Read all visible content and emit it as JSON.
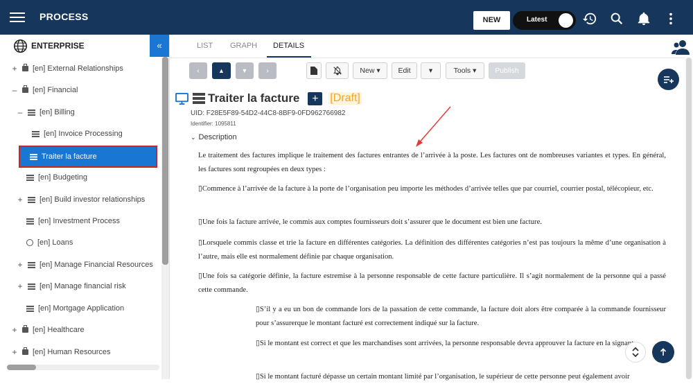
{
  "header": {
    "title": "PROCESS",
    "new_label": "NEW",
    "version_toggle": "Latest"
  },
  "sidebar": {
    "title": "ENTERPRISE",
    "collapse_glyph": "«",
    "items": [
      {
        "label": "[en] External Relationships",
        "toggle": "+",
        "icon": "bag"
      },
      {
        "label": "[en] Financial",
        "toggle": "–",
        "icon": "bag"
      },
      {
        "label": "[en] Billing",
        "toggle": "–",
        "icon": "list"
      },
      {
        "label": "[en] Invoice Processing",
        "toggle": "",
        "icon": "list"
      },
      {
        "label": "Traiter la facture",
        "toggle": "",
        "icon": "list",
        "selected": true
      },
      {
        "label": "[en] Budgeting",
        "toggle": "",
        "icon": "list"
      },
      {
        "label": "[en] Build investor relationships",
        "toggle": "+",
        "icon": "list"
      },
      {
        "label": "[en] Investment Process",
        "toggle": "",
        "icon": "list"
      },
      {
        "label": "[en] Loans",
        "toggle": "",
        "icon": "globe"
      },
      {
        "label": "[en] Manage Financial Resources",
        "toggle": "+",
        "icon": "list"
      },
      {
        "label": "[en] Manage financial risk",
        "toggle": "+",
        "icon": "list"
      },
      {
        "label": "[en] Mortgage Application",
        "toggle": "",
        "icon": "list"
      },
      {
        "label": "[en] Healthcare",
        "toggle": "+",
        "icon": "bag"
      },
      {
        "label": "[en] Human Resources",
        "toggle": "+",
        "icon": "bag"
      }
    ]
  },
  "tabs": [
    "LIST",
    "GRAPH",
    "DETAILS"
  ],
  "toolbar": {
    "new_label": "New ▾",
    "edit_label": "Edit",
    "edit_dropdown": "▾",
    "tools_label": "Tools ▾",
    "publish_label": "Publish"
  },
  "document": {
    "title": "Traiter la facture",
    "add_glyph": "+",
    "status": "[Draft]",
    "uid": "UID: F28E5F89-54D2-44C8-8BF9-0FD962766982",
    "identifier": "Identifier: 1095811",
    "description_label": "Description",
    "paragraphs": [
      "Le traitement des factures implique le traitement des factures entrantes de l’arrivée à la poste. Les factures ont de nombreuses variantes et types. En général, les factures sont regroupées en deux types :",
      "Commence à l’arrivée de la facture à la porte de l’organisation peu importe les méthodes d’arrivée telles que par courriel, courrier postal, télécopieur, etc.",
      "Une fois la facture arrivée, le commis aux comptes fournisseurs doit s’assurer que le document est bien une facture.",
      "Lorsquele commis classe et trie la facture en différentes catégories. La définition des différentes catégories n’est pas toujours la même d’une organisation à l’autre, mais elle est normalement définie par chaque organisation.",
      "Une fois sa catégorie définie, la facture estremise à la personne responsable de cette facture particulière. Il s’agit normalement de la personne qui a passé cette commande.",
      "S’il y a eu un bon de commande lors de la passation de cette commande, la facture doit alors être comparée à la commande fournisseur pour s’assurerque le montant facturé est correctement indiqué sur la facture.",
      "Si le montant est correct et que les marchandises sont arrivées, la personne responsable devra approuver la facture en la signant.",
      "Si le montant facturé dépasse un certain montant limité par l’organisation, le supérieur de cette personne peut également avoir"
    ]
  },
  "colors": {
    "primary": "#16365c",
    "accent": "#1976d2",
    "draft": "#f5a623",
    "annotation_arrow": "#e53935"
  }
}
